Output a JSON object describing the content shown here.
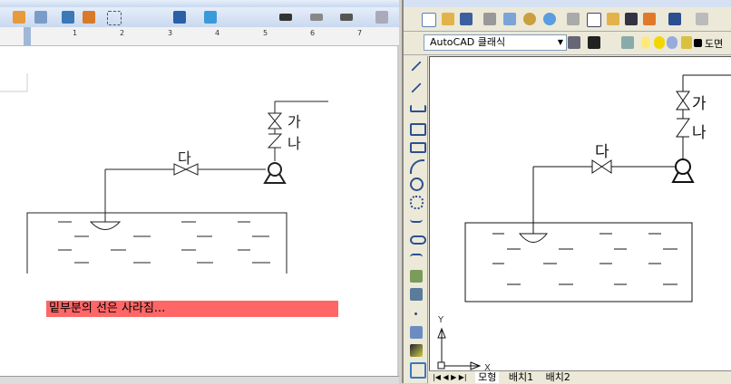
{
  "word": {
    "ruler_ticks": [
      "1",
      "2",
      "3",
      "4",
      "5",
      "6",
      "7"
    ],
    "note": "밑부분의 선은 사라짐...",
    "labels": {
      "ga": "가",
      "na": "나",
      "da": "다"
    },
    "note_color": "#ff6666"
  },
  "cad": {
    "workspace": "AutoCAD 클래식",
    "layer": "도면",
    "labels": {
      "ga": "가",
      "na": "나",
      "da": "다"
    },
    "ucs": {
      "x": "X",
      "y": "Y"
    },
    "tabs": [
      "모형",
      "배치1",
      "배치2"
    ]
  }
}
